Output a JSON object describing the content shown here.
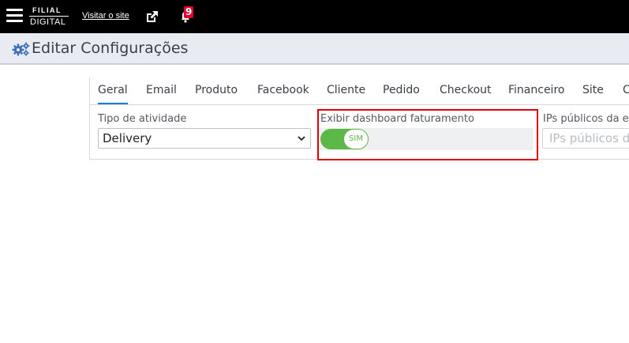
{
  "topbar": {
    "logo_line1": "FILIAL",
    "logo_line2": "DIGITAL",
    "visit_link": "Visitar o site",
    "notification_count": "9",
    "bg_color": "#000000"
  },
  "header": {
    "title": "Editar Configurações",
    "icon": "gears-icon"
  },
  "tabs": [
    {
      "label": "Geral",
      "active": true
    },
    {
      "label": "Email"
    },
    {
      "label": "Produto"
    },
    {
      "label": "Facebook"
    },
    {
      "label": "Cliente"
    },
    {
      "label": "Pedido"
    },
    {
      "label": "Checkout"
    },
    {
      "label": "Financeiro"
    },
    {
      "label": "Site"
    },
    {
      "label": "C"
    }
  ],
  "form": {
    "activity_type": {
      "label": "Tipo de atividade",
      "value": "Delivery"
    },
    "dashboard": {
      "label": "Exibir dashboard faturamento",
      "toggle_text": "SIM",
      "on": true
    },
    "public_ips": {
      "label": "IPs públicos da em",
      "placeholder": "IPs públicos da"
    }
  },
  "colors": {
    "accent": "#1a7ad4",
    "toggle_on": "#5cb947",
    "highlight": "#e00000",
    "badge": "#e4002b"
  }
}
